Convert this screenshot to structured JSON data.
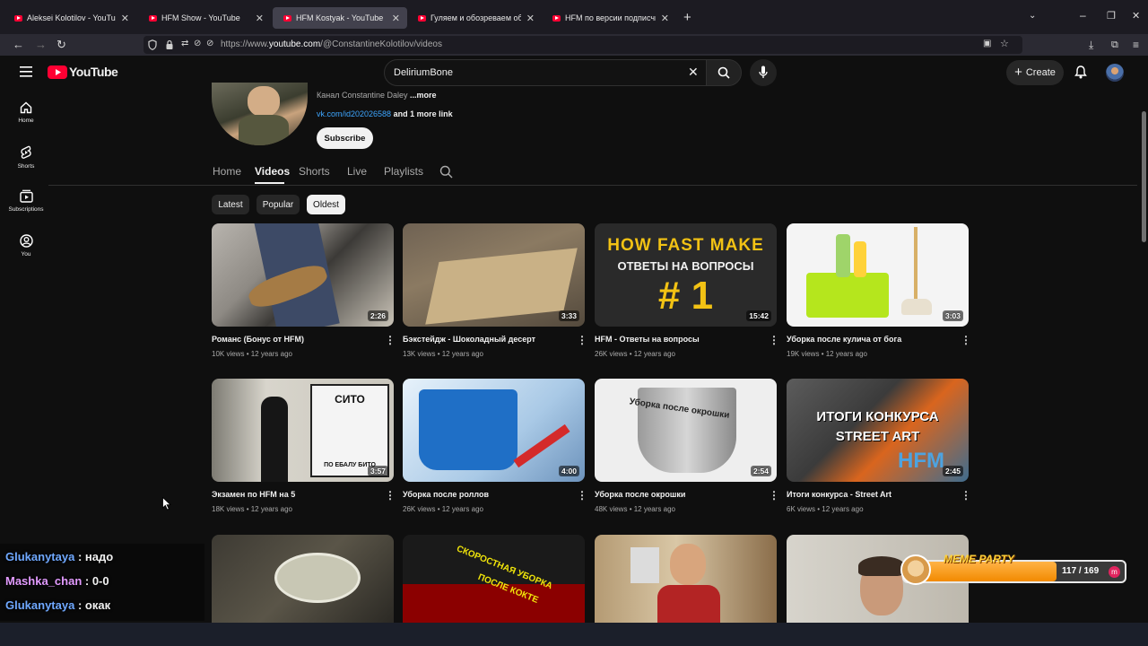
{
  "browser": {
    "tabs": [
      {
        "label": "Aleksei Kolotilov - YouTube",
        "active": false
      },
      {
        "label": "HFM Show - YouTube",
        "active": false
      },
      {
        "label": "HFM Kostyak - YouTube",
        "active": true
      },
      {
        "label": "Гуляем и обозреваем объекты",
        "active": false
      },
      {
        "label": "HFM по версии подписчиков",
        "active": false
      }
    ],
    "url_prefix": "https://www.",
    "url_host": "youtube.com",
    "url_path": "/@ConstantineKolotilov/videos"
  },
  "youtube": {
    "logo_text": "YouTube",
    "search_value": "DeliriumBone",
    "create_label": "Create"
  },
  "sidebar": {
    "items": [
      {
        "label": "Home",
        "icon": "home-icon"
      },
      {
        "label": "Shorts",
        "icon": "shorts-icon"
      },
      {
        "label": "Subscriptions",
        "icon": "subscriptions-icon"
      },
      {
        "label": "You",
        "icon": "you-icon"
      }
    ]
  },
  "channel": {
    "description": "Канал Constantine Daley",
    "more": "...more",
    "link": "vk.com/id202026588",
    "more_links": "and 1 more link",
    "subscribe_label": "Subscribe",
    "tabs": [
      "Home",
      "Videos",
      "Shorts",
      "Live",
      "Playlists"
    ],
    "active_tab": "Videos",
    "chips": [
      "Latest",
      "Popular",
      "Oldest"
    ],
    "selected_chip": "Oldest"
  },
  "videos": [
    {
      "title": "Романс (Бонус от HFM)",
      "views": "10K views",
      "age": "12 years ago",
      "duration": "2:26"
    },
    {
      "title": "Бэкстейдж - Шоколадный десерт",
      "views": "13K views",
      "age": "12 years ago",
      "duration": "3:33"
    },
    {
      "title": "HFM - Ответы на вопросы",
      "views": "26K views",
      "age": "12 years ago",
      "duration": "15:42",
      "thumb_text": [
        "HOW FAST MAKE",
        "ОТВЕТЫ НА ВОПРОСЫ",
        "# 1"
      ]
    },
    {
      "title": "Уборка после кулича от бога",
      "views": "19K views",
      "age": "12 years ago",
      "duration": "3:03"
    },
    {
      "title": "Экзамен по HFM на 5",
      "views": "18K views",
      "age": "12 years ago",
      "duration": "3:57",
      "thumb_text": [
        "СИТО",
        "ПО ЕБАЛУ БИТО"
      ]
    },
    {
      "title": "Уборка после роллов",
      "views": "26K views",
      "age": "12 years ago",
      "duration": "4:00"
    },
    {
      "title": "Уборка после окрошки",
      "views": "48K views",
      "age": "12 years ago",
      "duration": "2:54",
      "thumb_text": [
        "Уборка после окрошки"
      ]
    },
    {
      "title": "Итоги конкурса - Street Art",
      "views": "6K views",
      "age": "12 years ago",
      "duration": "2:45",
      "thumb_text": [
        "ИТОГИ КОНКУРСА",
        "STREET ART",
        "HFM"
      ]
    },
    {
      "title": "",
      "views": "",
      "age": "",
      "duration": ""
    },
    {
      "title": "",
      "views": "",
      "age": "",
      "duration": "",
      "thumb_text": [
        "СКОРОСТНАЯ УБОРКА",
        "ПОСЛЕ КОКТЕ"
      ]
    },
    {
      "title": "",
      "views": "",
      "age": "",
      "duration": ""
    },
    {
      "title": "",
      "views": "",
      "age": "",
      "duration": ""
    }
  ],
  "chat": [
    {
      "user": "Glukanytaya",
      "sep": " : ",
      "message": "надо",
      "color": "#6fa8ff"
    },
    {
      "user": "Mashka_chan",
      "sep": " : ",
      "message": "0-0",
      "color": "#e39bff"
    },
    {
      "user": "Glukanytaya",
      "sep": " : ",
      "message": "окак",
      "color": "#6fa8ff"
    }
  ],
  "meme_party": {
    "label": "MEME PARTY",
    "progress_text": "117 / 169",
    "progress": 0.6923
  }
}
